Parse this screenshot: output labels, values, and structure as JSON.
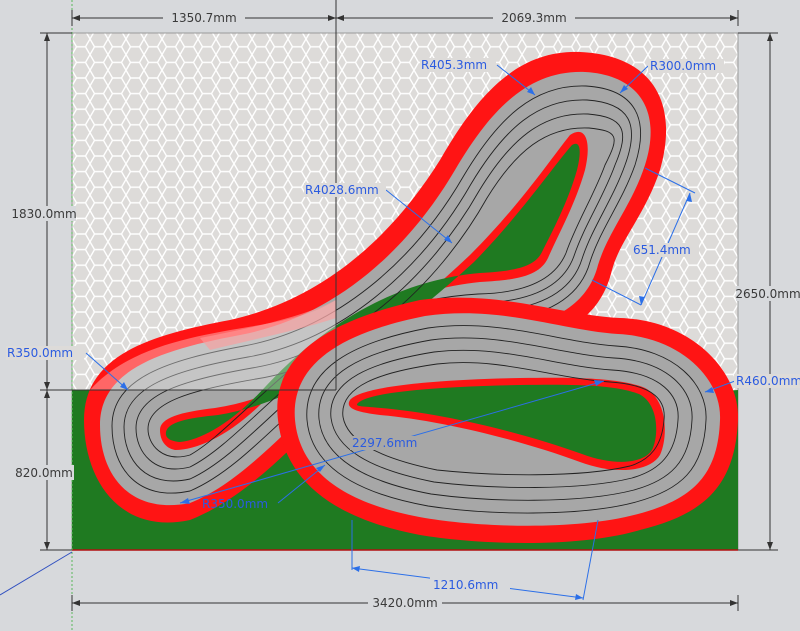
{
  "dimensions": {
    "top_left": "1350.7mm",
    "top_right": "2069.3mm",
    "left_height": "1830.0mm",
    "left_lower": "820.0mm",
    "right_height": "2650.0mm",
    "bottom_total": "3420.0mm",
    "bottom_inner": "1210.6mm",
    "radius_upper_left": "R405.3mm",
    "radius_upper_right": "R300.0mm",
    "radius_long": "R4028.6mm",
    "straight_length": "651.4mm",
    "radius_left": "R350.0mm",
    "radius_right": "R460.0mm",
    "radius_lower_inner": "R350.0mm",
    "center_length": "2297.6mm"
  },
  "colors": {
    "background": "#d7d9dc",
    "hex_floor": "#dddbd9",
    "grass": "#1f7a21",
    "kerb_red": "#ff1414",
    "track_gray": "#a7a7a7",
    "lane_line": "#222222",
    "dimension_blue": "#2b6fe8"
  }
}
